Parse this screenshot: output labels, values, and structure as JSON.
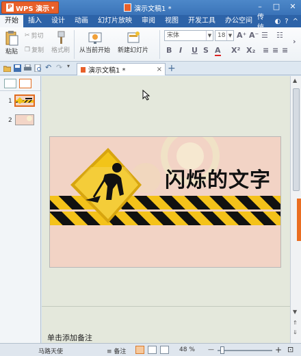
{
  "titlebar": {
    "app_name": "WPS 演示",
    "app_logo": "P",
    "doc_title": "演示文稿1 *",
    "controls": [
      "minimize",
      "maximize",
      "close"
    ]
  },
  "menubar": {
    "items": [
      "开始",
      "插入",
      "设计",
      "动画",
      "幻灯片放映",
      "审阅",
      "视图",
      "开发工具",
      "办公空间"
    ],
    "active": "开始",
    "right_label": "传统"
  },
  "ribbon": {
    "paste": "粘贴",
    "cut": "剪切",
    "copy": "复制",
    "format_painter": "格式刷",
    "from_current": "从当前开始",
    "new_slide": "新建幻灯片",
    "font_name": "宋体",
    "font_size": "18",
    "bold": "B",
    "italic": "I",
    "underline": "U",
    "strike": "S",
    "font_color": "A",
    "superscript": "X²",
    "subscript": "X₂"
  },
  "tabbar": {
    "doc_tab": "演示文稿1 *",
    "close_glyph": "×",
    "add_glyph": "+"
  },
  "leftpane": {
    "slides": [
      {
        "num": "1",
        "selected": true
      },
      {
        "num": "2",
        "selected": false
      }
    ]
  },
  "slide": {
    "title": "闪烁的文字",
    "colors": {
      "background": "#f2d3c5",
      "stripe_yellow": "#f4c21a",
      "stripe_black": "#111111",
      "sign_yellow": "#f2c418"
    }
  },
  "notes": {
    "placeholder": "单击添加备注"
  },
  "statusbar": {
    "theme": "马路天使",
    "notes_label": "备注",
    "zoom": "48 %",
    "zoom_minus": "—",
    "zoom_plus": "+"
  }
}
